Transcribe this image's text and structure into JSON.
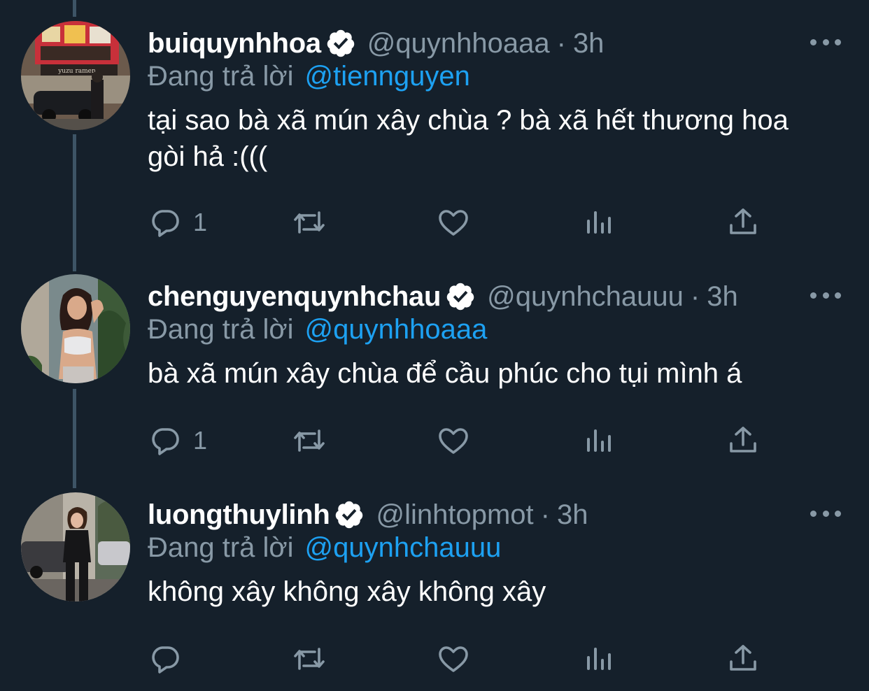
{
  "colors": {
    "background": "#15202b",
    "text_primary": "#ffffff",
    "text_secondary": "#8899a6",
    "link": "#1da1f2",
    "thread_line": "#3d5466"
  },
  "tweets": [
    {
      "name": "buiquynhhoa",
      "handle": "@quynhhoaaa",
      "separator": "·",
      "time": "3h",
      "reply_prefix": "Đang trả lời",
      "reply_to": "@tiennguyen",
      "text": "tại sao bà xã mún xây chùa ? bà xã hết thương hoa gòi hả :(((",
      "reply_count": "1",
      "avatar_icon": "profile-photo",
      "shop_sign": "yuzu ramen"
    },
    {
      "name": "chenguyenquynhchau",
      "handle": "@quynhchauuu",
      "separator": "·",
      "time": "3h",
      "reply_prefix": "Đang trả lời",
      "reply_to": "@quynhhoaaa",
      "text": "bà xã mún xây chùa để cầu phúc cho tụi mình á",
      "reply_count": "1",
      "avatar_icon": "profile-photo"
    },
    {
      "name": "luongthuylinh",
      "handle": "@linhtopmot",
      "separator": "·",
      "time": "3h",
      "reply_prefix": "Đang trả lời",
      "reply_to": "@quynhchauuu",
      "text": "không xây không xây không xây",
      "reply_count": "",
      "avatar_icon": "profile-photo"
    }
  ],
  "icons": {
    "verified": "verified-badge-icon",
    "reply": "reply-icon",
    "retweet": "retweet-icon",
    "like": "heart-icon",
    "analytics": "analytics-icon",
    "share": "share-icon",
    "more": "more-options-icon"
  }
}
